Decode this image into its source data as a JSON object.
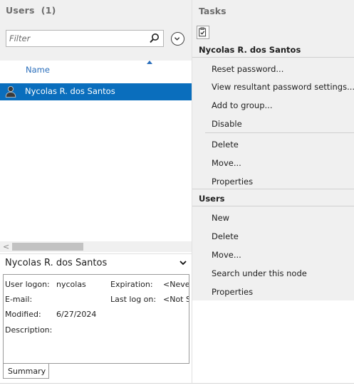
{
  "left": {
    "title": "Users",
    "count": "(1)",
    "filter": {
      "placeholder": "Filter",
      "value": ""
    },
    "column_header": "Name",
    "rows": [
      {
        "name": "Nycolas R. dos Santos",
        "selected": true
      }
    ],
    "scroll_left_arrow": "<"
  },
  "details": {
    "title": "Nycolas R. dos Santos",
    "user_logon_label": "User logon:",
    "user_logon_value": "nycolas",
    "email_label": "E-mail:",
    "modified_label": "Modified:",
    "modified_value": "6/27/2024",
    "description_label": "Description:",
    "expiration_label": "Expiration:",
    "expiration_value": "<Neve",
    "last_logon_label": "Last log on:",
    "last_logon_value": "<Not S",
    "tab": "Summary"
  },
  "tasks": {
    "title": "Tasks",
    "sections": [
      {
        "heading": "Nycolas R. dos Santos",
        "items": [
          "Reset password...",
          "View resultant password settings...",
          "Add to group...",
          "Disable",
          "Delete",
          "Move...",
          "Properties"
        ]
      },
      {
        "heading": "Users",
        "items": [
          "New",
          "Delete",
          "Move...",
          "Search under this node",
          "Properties"
        ]
      }
    ]
  },
  "colors": {
    "accent": "#0a6ebd",
    "link": "#2a6ebb",
    "pane_bg": "#f0f0f0"
  },
  "icons": [
    "search-icon",
    "chevron-down-icon",
    "user-icon",
    "clipboard-check-icon"
  ]
}
